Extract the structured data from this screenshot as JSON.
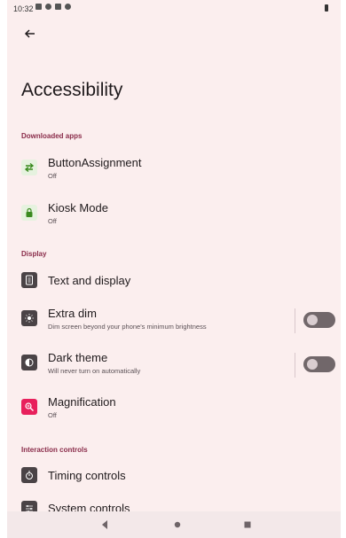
{
  "status_bar": {
    "time": "10:32"
  },
  "page": {
    "title": "Accessibility"
  },
  "sections": {
    "downloaded": "Downloaded apps",
    "display": "Display",
    "interaction": "Interaction controls"
  },
  "items": {
    "button_assignment": {
      "title": "ButtonAssignment",
      "subtitle": "Off"
    },
    "kiosk_mode": {
      "title": "Kiosk Mode",
      "subtitle": "Off"
    },
    "text_display": {
      "title": "Text and display"
    },
    "extra_dim": {
      "title": "Extra dim",
      "subtitle": "Dim screen beyond your phone's minimum brightness",
      "toggle_on": false
    },
    "dark_theme": {
      "title": "Dark theme",
      "subtitle": "Will never turn on automatically",
      "toggle_on": false
    },
    "magnification": {
      "title": "Magnification",
      "subtitle": "Off"
    },
    "timing_controls": {
      "title": "Timing controls"
    },
    "system_controls": {
      "title": "System controls"
    }
  },
  "icons": {
    "button_assignment": "swap-arrows-icon",
    "kiosk_mode": "lock-icon",
    "text_display": "text-display-icon",
    "extra_dim": "brightness-icon",
    "dark_theme": "contrast-icon",
    "magnification": "magnify-icon",
    "timing_controls": "timer-hand-icon",
    "system_controls": "sliders-icon"
  },
  "colors": {
    "accent": "#8a2c4a",
    "background": "#fbeeee",
    "icon_dark": "#4a4346",
    "icon_green_bg": "#e6f2df",
    "icon_green": "#3a8a1f",
    "magnification": "#e8205c"
  }
}
